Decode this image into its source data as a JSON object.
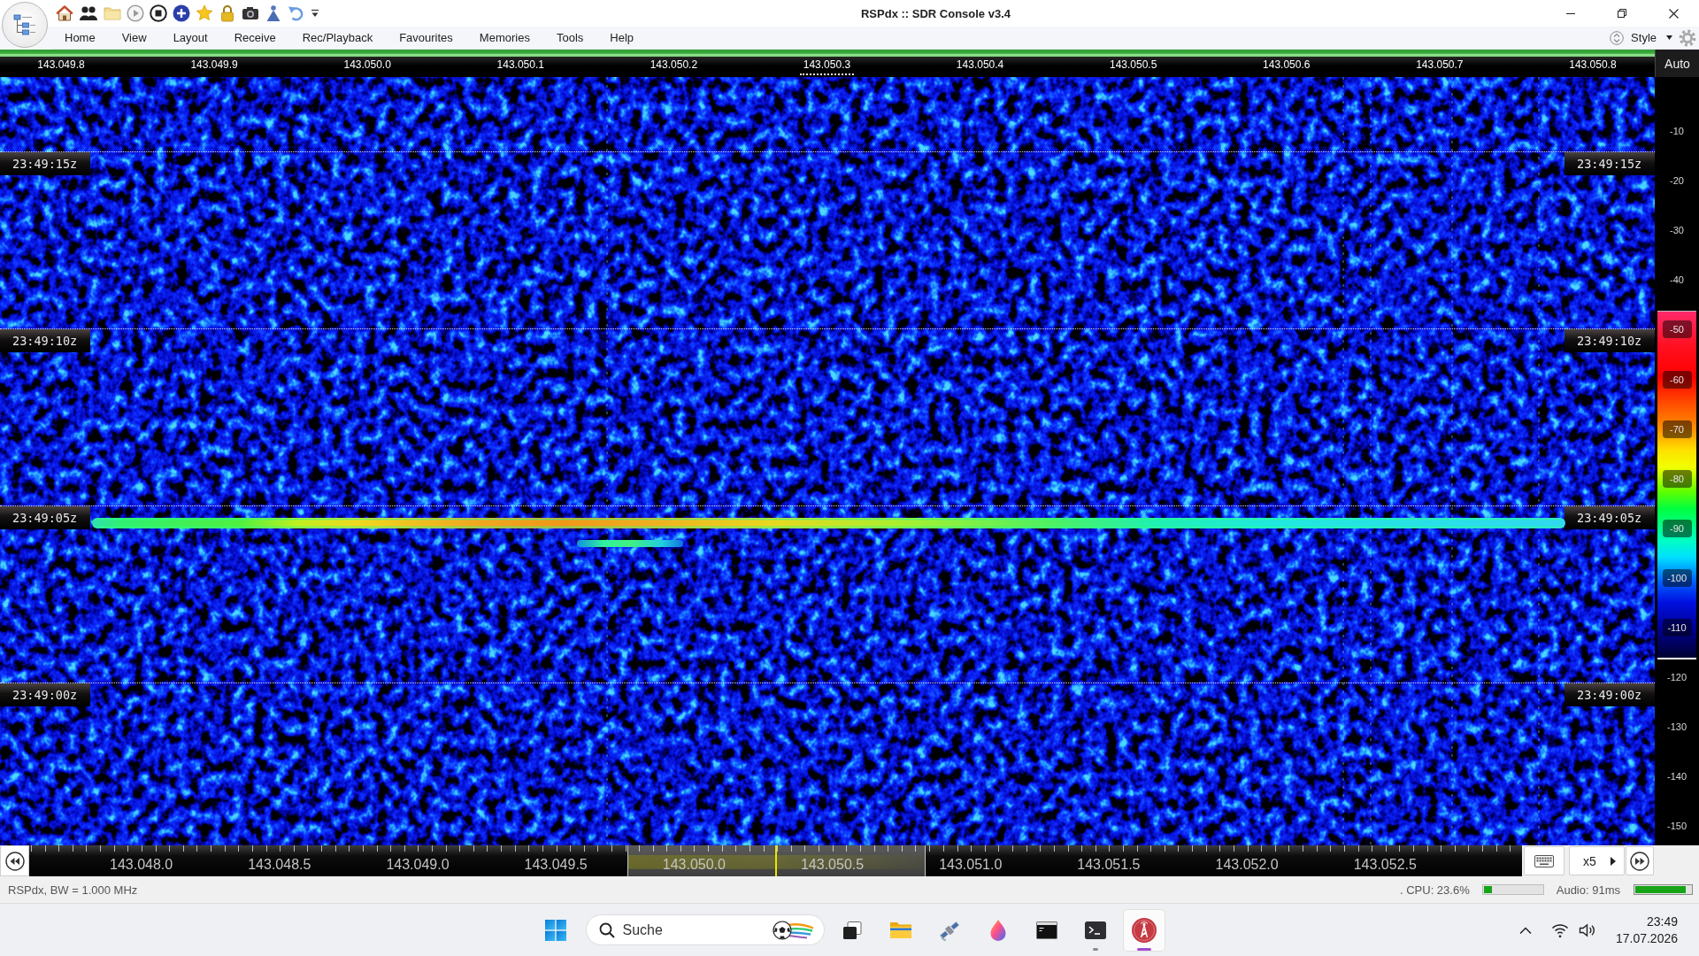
{
  "window": {
    "title": "RSPdx :: SDR Console v3.4"
  },
  "menu": {
    "items": [
      "Home",
      "View",
      "Layout",
      "Receive",
      "Rec/Playback",
      "Favourites",
      "Memories",
      "Tools",
      "Help"
    ],
    "style_label": "Style"
  },
  "frequency_ruler": {
    "labels": [
      {
        "text": "143.049.8",
        "marked": false
      },
      {
        "text": "143.049.9",
        "marked": false
      },
      {
        "text": "143.050.0",
        "marked": false
      },
      {
        "text": "143.050.1",
        "marked": false
      },
      {
        "text": "143.050.2",
        "marked": false
      },
      {
        "text": "143.050.3",
        "marked": true
      },
      {
        "text": "143.050.4",
        "marked": false
      },
      {
        "text": "143.050.5",
        "marked": false
      },
      {
        "text": "143.050.6",
        "marked": false
      },
      {
        "text": "143.050.7",
        "marked": false
      },
      {
        "text": "143.050.8",
        "marked": false
      }
    ],
    "auto_button": "Auto"
  },
  "waterfall": {
    "time_marks": [
      {
        "left": "23:49:15z",
        "right": "23:49:15z"
      },
      {
        "left": "23:49:10z",
        "right": "23:49:10z"
      },
      {
        "left": "23:49:05z",
        "right": "23:49:05z"
      },
      {
        "left": "23:49:00z",
        "right": "23:49:00z"
      }
    ]
  },
  "level_scale": {
    "ticks": [
      {
        "label": "-10",
        "kind": "plain"
      },
      {
        "label": "-20",
        "kind": "plain"
      },
      {
        "label": "-30",
        "kind": "plain"
      },
      {
        "label": "-40",
        "kind": "plain"
      },
      {
        "label": "-50",
        "kind": "band"
      },
      {
        "label": "-60",
        "kind": "band"
      },
      {
        "label": "-70",
        "kind": "band"
      },
      {
        "label": "-80",
        "kind": "band"
      },
      {
        "label": "-90",
        "kind": "band"
      },
      {
        "label": "-100",
        "kind": "band"
      },
      {
        "label": "-110",
        "kind": "band"
      },
      {
        "label": "-120",
        "kind": "plain"
      },
      {
        "label": "-130",
        "kind": "plain"
      },
      {
        "label": "-140",
        "kind": "plain"
      },
      {
        "label": "-150",
        "kind": "plain"
      }
    ]
  },
  "span_ruler": {
    "labels": [
      "143.048.0",
      "143.048.5",
      "143.049.0",
      "143.049.5",
      "143.050.0",
      "143.050.5",
      "143.051.0",
      "143.051.5",
      "143.052.0",
      "143.052.5"
    ],
    "zoom": "x5"
  },
  "status_bar": {
    "device": "RSPdx, BW = 1.000 MHz",
    "cpu": ". CPU: 23.6%",
    "cpu_meter": {
      "level": 0.14
    },
    "audio": "Audio: 91ms",
    "audio_meter": {
      "level": 0.91
    }
  },
  "taskbar": {
    "search": {
      "placeholder": "Suche"
    },
    "apps": [
      {
        "kind": "task_view",
        "running": false,
        "selected": false
      },
      {
        "kind": "folder",
        "running": false,
        "selected": false
      },
      {
        "kind": "satellite",
        "running": false,
        "selected": false
      },
      {
        "kind": "drop",
        "running": false,
        "selected": false
      },
      {
        "kind": "console",
        "running": false,
        "selected": false
      },
      {
        "kind": "terminal",
        "running": true,
        "selected": false
      },
      {
        "kind": "radio",
        "running": true,
        "selected": true
      }
    ],
    "clock": {
      "time": "23:49",
      "date": "17.07.2026"
    }
  }
}
